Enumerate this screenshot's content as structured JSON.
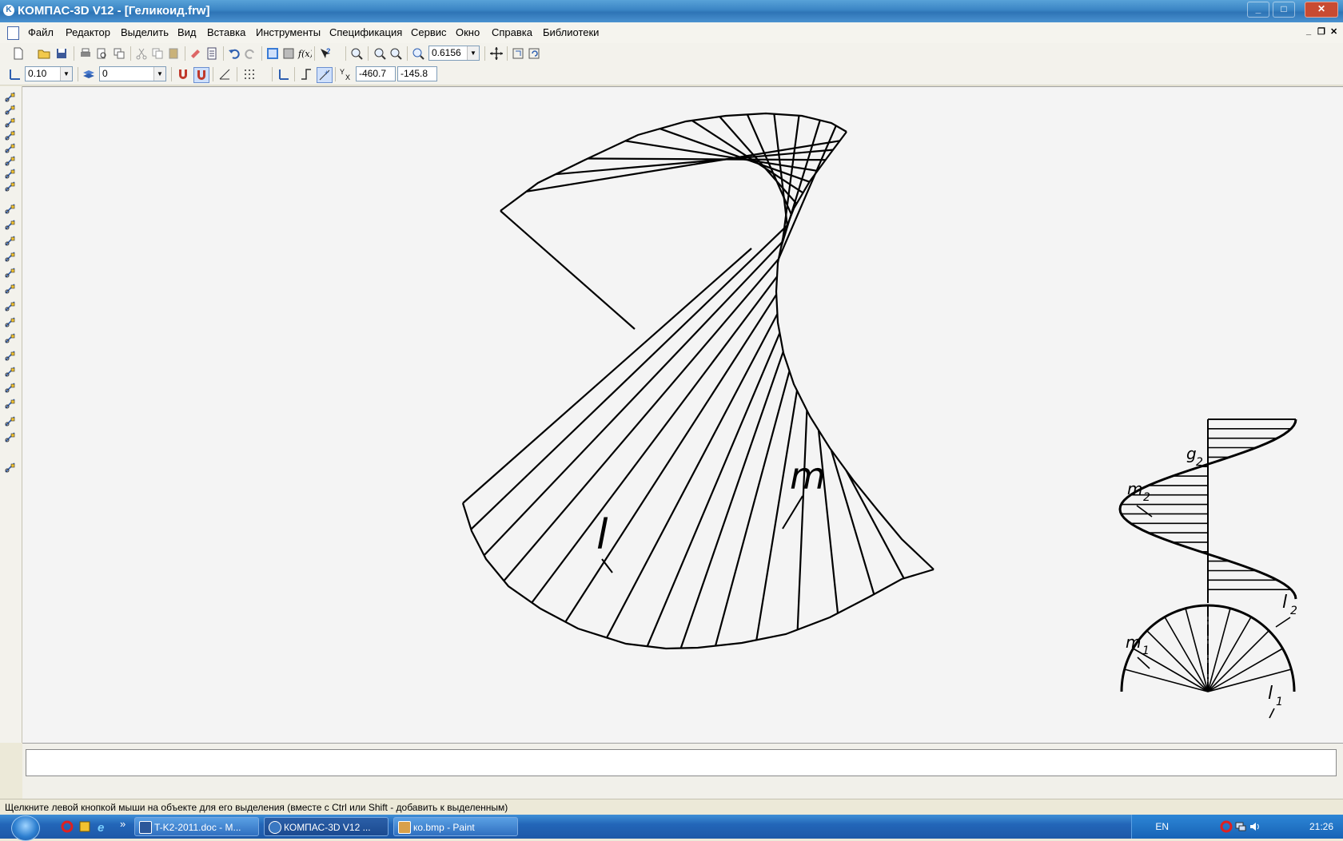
{
  "window": {
    "title": "КОМПАС-3D V12 - [Геликоид.frw]",
    "minimize": "_",
    "restore": "□",
    "close": "✕"
  },
  "menu": {
    "items": [
      "Файл",
      "Редактор",
      "Выделить",
      "Вид",
      "Вставка",
      "Инструменты",
      "Спецификация",
      "Сервис",
      "Окно",
      "Справка",
      "Библиотеки"
    ],
    "mdi": {
      "minimize": "_",
      "restore": "❐",
      "close": "✕"
    }
  },
  "toolbar1": {
    "zoom_value": "0.6156"
  },
  "toolbar2": {
    "step_value": "0.10",
    "layer_value": "0",
    "coord_x": "-460.7",
    "coord_y": "-145.8"
  },
  "drawing": {
    "labels": {
      "m": "m",
      "l": "l",
      "g2": "g",
      "g2_sub": "2",
      "m2": "m",
      "m2_sub": "2",
      "l2": "l",
      "l2_sub": "2",
      "m1": "m",
      "m1_sub": "1",
      "l1": "l",
      "l1_sub": "1"
    }
  },
  "status": {
    "message": "Щелкните левой кнопкой мыши на объекте для его выделения (вместе с Ctrl или Shift - добавить к выделенным)"
  },
  "taskbar": {
    "tasks": [
      {
        "label": "T-K2-2011.doc - M...",
        "color": "#2b579a"
      },
      {
        "label": "КОМПАС-3D V12 ...",
        "color": "#3a78c2"
      },
      {
        "label": "ко.bmp - Paint",
        "color": "#d9a04a"
      }
    ],
    "more": "»",
    "language": "EN",
    "time": "21:26"
  },
  "colors": {
    "accent": "#2e74b6",
    "canvas": "#f4f4f4",
    "ink": "#000000"
  }
}
